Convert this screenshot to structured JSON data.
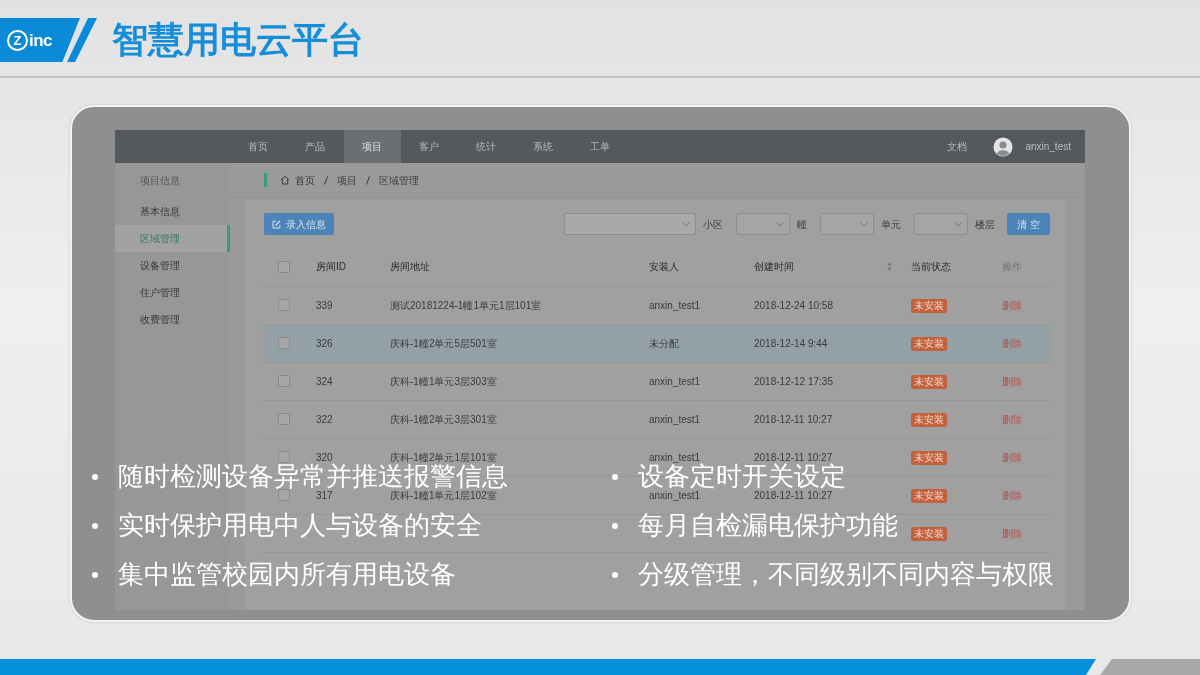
{
  "header": {
    "logo": {
      "mark": "Z",
      "text": "inc"
    },
    "title": "智慧用电云平台"
  },
  "screenshot": {
    "nav": {
      "items": [
        {
          "label": "首页",
          "selected": false
        },
        {
          "label": "产品",
          "selected": false
        },
        {
          "label": "项目",
          "selected": true
        },
        {
          "label": "客户",
          "selected": false
        },
        {
          "label": "统计",
          "selected": false
        },
        {
          "label": "系统",
          "selected": false
        },
        {
          "label": "工单",
          "selected": false
        }
      ],
      "docs": "文档",
      "user": "anxin_test"
    },
    "sidebar": {
      "title": "项目信息",
      "items": [
        {
          "label": "基本信息",
          "selected": false
        },
        {
          "label": "区域管理",
          "selected": true
        },
        {
          "label": "设备管理",
          "selected": false
        },
        {
          "label": "住户管理",
          "selected": false
        },
        {
          "label": "收费管理",
          "selected": false
        }
      ]
    },
    "breadcrumb": [
      "首页",
      "项目",
      "区域管理"
    ],
    "toolbar": {
      "add_button": "录入信息",
      "filters": [
        {
          "label": "小区"
        },
        {
          "label": "幢"
        },
        {
          "label": "单元"
        },
        {
          "label": "楼层"
        }
      ],
      "clear_button": "清 空"
    },
    "table": {
      "columns": [
        {
          "kind": "checkbox",
          "checked": false
        },
        {
          "kind": "text",
          "label": "房间ID"
        },
        {
          "kind": "text",
          "label": "房间地址"
        },
        {
          "kind": "text",
          "label": "安装人"
        },
        {
          "kind": "sortable",
          "label": "创建时间"
        },
        {
          "kind": "text",
          "label": "当前状态"
        },
        {
          "kind": "action",
          "label": "操作"
        }
      ],
      "rows": [
        {
          "selected": false,
          "checked": false,
          "id": "339",
          "address": "测试20181224-1幢1单元1层101室",
          "installer": "anxin_test1",
          "created": "2018-12-24 10:58",
          "status": "未安装",
          "action": "删除"
        },
        {
          "selected": true,
          "checked": false,
          "id": "326",
          "address": "庆科-1幢2单元5层501室",
          "installer": "未分配",
          "created": "2018-12-14 9:44",
          "status": "未安装",
          "action": "删除"
        },
        {
          "selected": false,
          "checked": false,
          "id": "324",
          "address": "庆科-1幢1单元3层303室",
          "installer": "anxin_test1",
          "created": "2018-12-12 17:35",
          "status": "未安装",
          "action": "删除"
        },
        {
          "selected": false,
          "checked": false,
          "id": "322",
          "address": "庆科-1幢2单元3层301室",
          "installer": "anxin_test1",
          "created": "2018-12-11 10:27",
          "status": "未安装",
          "action": "删除"
        },
        {
          "selected": false,
          "checked": false,
          "id": "320",
          "address": "庆科-1幢2单元1层101室",
          "installer": "anxin_test1",
          "created": "2018-12-11 10:27",
          "status": "未安装",
          "action": "删除"
        },
        {
          "selected": false,
          "checked": false,
          "id": "317",
          "address": "庆科-1幢1单元1层102室",
          "installer": "anxin_test1",
          "created": "2018-12-11 10:27",
          "status": "未安装",
          "action": "删除"
        },
        {
          "status": "未安装",
          "action": "删除"
        }
      ]
    }
  },
  "bullets": [
    "随时检测设备异常并推送报警信息",
    "设备定时开关设定",
    "实时保护用电中人与设备的安全",
    "每月自检漏电保护功能",
    "集中监管校园内所有用电设备",
    "分级管理，不同级别不同内容与权限"
  ]
}
